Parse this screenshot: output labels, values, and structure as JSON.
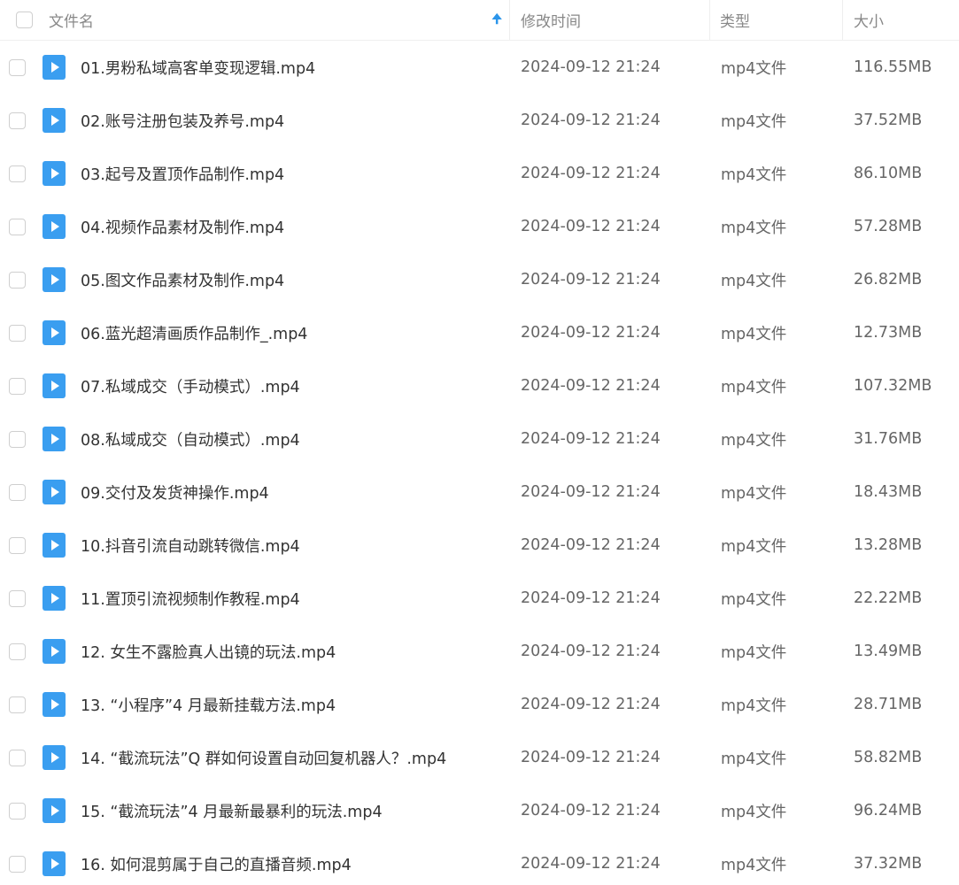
{
  "header": {
    "filename_label": "文件名",
    "modified_label": "修改时间",
    "type_label": "类型",
    "size_label": "大小",
    "sort_arrow": "🠉"
  },
  "colors": {
    "accent": "#2b95ea",
    "icon_blue": "#3a9ef0",
    "text": "#333333",
    "muted": "#666666"
  },
  "icons": {
    "file": "video-file-icon",
    "sort": "sort-ascending-icon"
  },
  "files": [
    {
      "name": "01.男粉私域高客单变现逻辑.mp4",
      "modified": "2024-09-12 21:24",
      "type": "mp4文件",
      "size": "116.55MB"
    },
    {
      "name": "02.账号注册包装及养号.mp4",
      "modified": "2024-09-12 21:24",
      "type": "mp4文件",
      "size": "37.52MB"
    },
    {
      "name": "03.起号及置顶作品制作.mp4",
      "modified": "2024-09-12 21:24",
      "type": "mp4文件",
      "size": "86.10MB"
    },
    {
      "name": "04.视频作品素材及制作.mp4",
      "modified": "2024-09-12 21:24",
      "type": "mp4文件",
      "size": "57.28MB"
    },
    {
      "name": "05.图文作品素材及制作.mp4",
      "modified": "2024-09-12 21:24",
      "type": "mp4文件",
      "size": "26.82MB"
    },
    {
      "name": "06.蓝光超清画质作品制作_.mp4",
      "modified": "2024-09-12 21:24",
      "type": "mp4文件",
      "size": "12.73MB"
    },
    {
      "name": "07.私域成交（手动模式）.mp4",
      "modified": "2024-09-12 21:24",
      "type": "mp4文件",
      "size": "107.32MB"
    },
    {
      "name": "08.私域成交（自动模式）.mp4",
      "modified": "2024-09-12 21:24",
      "type": "mp4文件",
      "size": "31.76MB"
    },
    {
      "name": "09.交付及发货神操作.mp4",
      "modified": "2024-09-12 21:24",
      "type": "mp4文件",
      "size": "18.43MB"
    },
    {
      "name": "10.抖音引流自动跳转微信.mp4",
      "modified": "2024-09-12 21:24",
      "type": "mp4文件",
      "size": "13.28MB"
    },
    {
      "name": "11.置顶引流视频制作教程.mp4",
      "modified": "2024-09-12 21:24",
      "type": "mp4文件",
      "size": "22.22MB"
    },
    {
      "name": "12. 女生不露脸真人出镜的玩法.mp4",
      "modified": "2024-09-12 21:24",
      "type": "mp4文件",
      "size": "13.49MB"
    },
    {
      "name": "13. “小程序”4 月最新挂载方法.mp4",
      "modified": "2024-09-12 21:24",
      "type": "mp4文件",
      "size": "28.71MB"
    },
    {
      "name": "14. “截流玩法”Q 群如何设置自动回复机器人？.mp4",
      "modified": "2024-09-12 21:24",
      "type": "mp4文件",
      "size": "58.82MB"
    },
    {
      "name": "15. “截流玩法”4 月最新最暴利的玩法.mp4",
      "modified": "2024-09-12 21:24",
      "type": "mp4文件",
      "size": "96.24MB"
    },
    {
      "name": "16. 如何混剪属于自己的直播音频.mp4",
      "modified": "2024-09-12 21:24",
      "type": "mp4文件",
      "size": "37.32MB"
    }
  ]
}
